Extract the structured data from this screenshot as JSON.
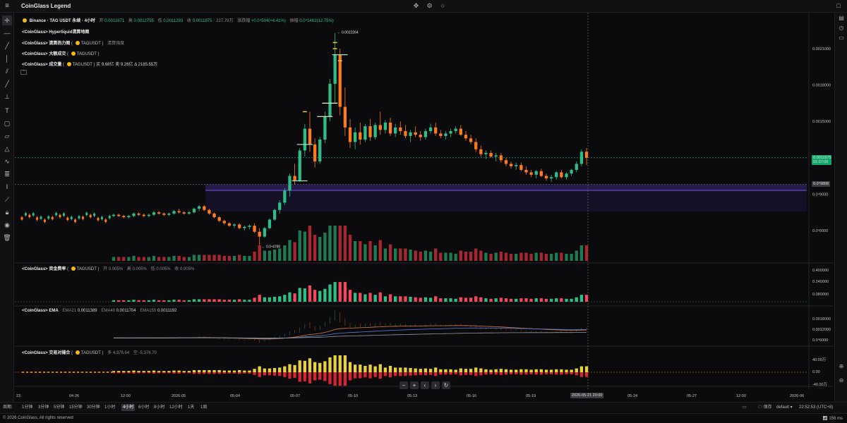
{
  "app": {
    "title": "CoinGlass Legend"
  },
  "main_legend": {
    "exchange": "Binance · TAG USDT 永续 · 4小时",
    "open_label": "开",
    "open": "0.0011671",
    "high_label": "高",
    "high": "0.0012755",
    "low_label": "低",
    "low": "0.0011293",
    "close_label": "收",
    "close": "0.0011975",
    "volume": "227.79万",
    "change_label": "涨跌幅",
    "change": "+0.0⁴504(+4.41%)",
    "amplitude_label": "振幅",
    "amplitude": "0.0⁴1462(12.75%)"
  },
  "indicators": {
    "hyperliquid": "<CoinGlass> Hyperliquid清算地图",
    "liq_force": "<CoinGlass> 清算热力图",
    "liq_force_symbol": "TAGUSDT",
    "liq_force_extra": "清算强度",
    "large_trades": "<CoinGlass> 大额成交",
    "large_trades_symbol": "TAGUSDT",
    "volume": "<CoinGlass> 成交量",
    "volume_symbol": "TAGUSDT",
    "volume_buy": "买 9.68亿",
    "volume_sell": "卖 9.26亿",
    "volume_delta": "Δ 2185.55万",
    "collapse_icon": "^"
  },
  "funding": {
    "title": "<CoinGlass> 资金费率",
    "symbol": "TAGUSDT",
    "open": "开 0.005%",
    "high": "高 0.005%",
    "low": "低 0.005%",
    "close": "收 0.005%"
  },
  "ema": {
    "title": "<CoinGlass> EMA",
    "ema21_label": "EMA21",
    "ema21": "0.0011389",
    "ema49_label": "EMA49",
    "ema49": "0.0011704",
    "ema155_label": "EMA155",
    "ema155": "0.0011192"
  },
  "trade_pair": {
    "title": "<CoinGlass> 交易对撮合",
    "symbol": "TAGUSDT",
    "buy": "多 4,376.64",
    "sell": "空 -5,376.70"
  },
  "price_axis": {
    "ticks": [
      "0.0021000",
      "0.0018000",
      "0.0015000",
      "0.0012000",
      "0.0⁴9000",
      "0.0⁴6000"
    ],
    "last_price": "0.0011975",
    "countdown": "01:07:06",
    "cross_price": "0.0⁴9808"
  },
  "chart_annotations": {
    "high_marker": "0.0022264",
    "low_marker": "0.0⁴4780"
  },
  "funding_axis": {
    "ticks": [
      "0.400000",
      "0.240000",
      "0.080000"
    ]
  },
  "ema_axis": {
    "ticks": [
      "0.0018000",
      "0.0012000",
      "0.0⁴6000"
    ]
  },
  "pair_axis": {
    "ticks": [
      "40.00万",
      "0.00",
      "-40.00万"
    ]
  },
  "time_axis": {
    "ticks": [
      "23",
      "04-26",
      "12:00",
      "2026-05",
      "05-04",
      "05-07",
      "05-10",
      "05-13",
      "05-16",
      "05-19",
      "05-24",
      "05-27",
      "12:00",
      "2026-06"
    ],
    "crosshair": "2026-05-21 20:00"
  },
  "periods": {
    "label": "周期:",
    "items": [
      "1分钟",
      "3分钟",
      "5分钟",
      "15分钟",
      "30分钟",
      "1小时",
      "4小时",
      "6小时",
      "8小时",
      "12小时",
      "1天",
      "1周"
    ],
    "active": "4小时",
    "save": "保存",
    "layout": "default",
    "clock": "22:52:53 (UTC+8)"
  },
  "footer": {
    "copyright": "© 2026 CoinGlass, All rights reserved",
    "ping": "156 ms"
  },
  "colors": {
    "up": "#2ebd85",
    "down": "#f6465d",
    "candle_down": "#ff7a1a",
    "bg": "#0b0b0d",
    "last_price_bg": "#0fa86b",
    "ema_a": "#d97b45",
    "ema_b": "#5b7bd6",
    "ema_c": "#999999"
  },
  "chart_data": {
    "type": "candlestick",
    "candles": [
      [
        0.00072,
        0.00074,
        0.00071,
        0.00073
      ],
      [
        0.00073,
        0.00074,
        0.00071,
        0.00072
      ],
      [
        0.00072,
        0.00073,
        0.0007,
        0.00071
      ],
      [
        0.00071,
        0.00073,
        0.0007,
        0.00072
      ],
      [
        0.00072,
        0.00075,
        0.00071,
        0.00074
      ],
      [
        0.00074,
        0.00075,
        0.00072,
        0.00073
      ],
      [
        0.00073,
        0.00074,
        0.00071,
        0.00072
      ],
      [
        0.00072,
        0.00074,
        0.00071,
        0.00073
      ],
      [
        0.00073,
        0.00076,
        0.00072,
        0.00075
      ],
      [
        0.00075,
        0.00076,
        0.00073,
        0.00074
      ],
      [
        0.00074,
        0.00075,
        0.00072,
        0.00073
      ],
      [
        0.00073,
        0.00075,
        0.00072,
        0.00074
      ],
      [
        0.00074,
        0.00077,
        0.00073,
        0.00076
      ],
      [
        0.00076,
        0.00078,
        0.00074,
        0.00075
      ],
      [
        0.00075,
        0.00076,
        0.00073,
        0.00074
      ],
      [
        0.00074,
        0.00076,
        0.00073,
        0.00075
      ],
      [
        0.00075,
        0.00079,
        0.00074,
        0.00078
      ],
      [
        0.00078,
        0.00081,
        0.00076,
        0.0008
      ],
      [
        0.0008,
        0.00081,
        0.00076,
        0.00077
      ],
      [
        0.00077,
        0.00078,
        0.00073,
        0.00074
      ],
      [
        0.00074,
        0.00075,
        0.0007,
        0.00071
      ],
      [
        0.00071,
        0.00072,
        0.00067,
        0.00068
      ],
      [
        0.00068,
        0.00069,
        0.00065,
        0.00066
      ],
      [
        0.00066,
        0.00067,
        0.00063,
        0.00064
      ],
      [
        0.00064,
        0.00066,
        0.00062,
        0.00065
      ],
      [
        0.00065,
        0.00066,
        0.00061,
        0.00062
      ],
      [
        0.00062,
        0.00064,
        0.0006,
        0.00063
      ],
      [
        0.00063,
        0.00065,
        0.00061,
        0.00064
      ],
      [
        0.00064,
        0.00066,
        0.00058,
        0.00059
      ],
      [
        0.00059,
        0.00062,
        0.00048,
        0.00055
      ],
      [
        0.00055,
        0.00063,
        0.00054,
        0.00062
      ],
      [
        0.00062,
        0.0007,
        0.00061,
        0.00069
      ],
      [
        0.00069,
        0.00078,
        0.00068,
        0.00077
      ],
      [
        0.00077,
        0.00085,
        0.00074,
        0.00083
      ],
      [
        0.00083,
        0.00095,
        0.00081,
        0.00093
      ],
      [
        0.00093,
        0.00107,
        0.00088,
        0.00105
      ],
      [
        0.00105,
        0.00115,
        0.00098,
        0.00101
      ],
      [
        0.00101,
        0.00128,
        0.001,
        0.00126
      ],
      [
        0.00126,
        0.00148,
        0.00121,
        0.00144
      ],
      [
        0.00144,
        0.00158,
        0.00125,
        0.00131
      ],
      [
        0.00131,
        0.00136,
        0.00112,
        0.00117
      ],
      [
        0.00117,
        0.00137,
        0.00115,
        0.00135
      ],
      [
        0.00135,
        0.00158,
        0.00132,
        0.00154
      ],
      [
        0.00154,
        0.00185,
        0.0015,
        0.00181
      ],
      [
        0.00181,
        0.00223,
        0.00165,
        0.00205
      ],
      [
        0.00205,
        0.0021,
        0.00155,
        0.00162
      ],
      [
        0.00162,
        0.00178,
        0.00138,
        0.00145
      ],
      [
        0.00145,
        0.00152,
        0.00128,
        0.00133
      ],
      [
        0.00133,
        0.00145,
        0.00127,
        0.00141
      ],
      [
        0.00141,
        0.00149,
        0.00131,
        0.00135
      ],
      [
        0.00135,
        0.00148,
        0.00133,
        0.00146
      ],
      [
        0.00146,
        0.00152,
        0.00134,
        0.00137
      ],
      [
        0.00137,
        0.00149,
        0.00135,
        0.00147
      ],
      [
        0.00147,
        0.00158,
        0.00139,
        0.00143
      ],
      [
        0.00143,
        0.00151,
        0.0014,
        0.00149
      ],
      [
        0.00149,
        0.00153,
        0.00138,
        0.0014
      ],
      [
        0.0014,
        0.00148,
        0.00137,
        0.00145
      ],
      [
        0.00145,
        0.0015,
        0.00139,
        0.00142
      ],
      [
        0.00142,
        0.00147,
        0.00136,
        0.00138
      ],
      [
        0.00138,
        0.00143,
        0.00133,
        0.00141
      ],
      [
        0.00141,
        0.00146,
        0.00137,
        0.00139
      ],
      [
        0.00139,
        0.00142,
        0.00134,
        0.00137
      ],
      [
        0.00137,
        0.00144,
        0.00135,
        0.00142
      ],
      [
        0.00142,
        0.00148,
        0.0014,
        0.00145
      ],
      [
        0.00145,
        0.00149,
        0.00138,
        0.0014
      ],
      [
        0.0014,
        0.00143,
        0.00136,
        0.00138
      ],
      [
        0.00138,
        0.00142,
        0.00135,
        0.0014
      ],
      [
        0.0014,
        0.00144,
        0.00137,
        0.00142
      ],
      [
        0.00142,
        0.00146,
        0.0014,
        0.00144
      ],
      [
        0.00144,
        0.00147,
        0.00138,
        0.00139
      ],
      [
        0.00139,
        0.00142,
        0.00134,
        0.00136
      ],
      [
        0.00136,
        0.00139,
        0.00131,
        0.00133
      ],
      [
        0.00133,
        0.00136,
        0.00125,
        0.00127
      ],
      [
        0.00127,
        0.0013,
        0.00121,
        0.00123
      ],
      [
        0.00123,
        0.00126,
        0.00119,
        0.00124
      ],
      [
        0.00124,
        0.00126,
        0.0012,
        0.00121
      ],
      [
        0.00121,
        0.00124,
        0.00117,
        0.00122
      ],
      [
        0.00122,
        0.00124,
        0.00116,
        0.00118
      ],
      [
        0.00118,
        0.0012,
        0.00113,
        0.00115
      ],
      [
        0.00115,
        0.00117,
        0.00111,
        0.00113
      ],
      [
        0.00113,
        0.00116,
        0.0011,
        0.00114
      ],
      [
        0.00114,
        0.00116,
        0.00109,
        0.0011
      ],
      [
        0.0011,
        0.00113,
        0.00106,
        0.00108
      ],
      [
        0.00108,
        0.0011,
        0.00104,
        0.00106
      ],
      [
        0.00106,
        0.0011,
        0.00103,
        0.00109
      ],
      [
        0.00109,
        0.00111,
        0.00104,
        0.00105
      ],
      [
        0.00105,
        0.00107,
        0.00101,
        0.00103
      ],
      [
        0.00103,
        0.00106,
        0.001,
        0.00104
      ],
      [
        0.00104,
        0.00109,
        0.00102,
        0.00108
      ],
      [
        0.00108,
        0.0011,
        0.00103,
        0.00104
      ],
      [
        0.00104,
        0.00108,
        0.00102,
        0.00107
      ],
      [
        0.00107,
        0.00111,
        0.00105,
        0.0011
      ],
      [
        0.0011,
        0.00117,
        0.00108,
        0.00115
      ],
      [
        0.00115,
        0.00127,
        0.00113,
        0.00125
      ],
      [
        0.00125,
        0.00128,
        0.00114,
        0.0012
      ]
    ],
    "price_range": [
      0.00035,
      0.00235
    ]
  }
}
